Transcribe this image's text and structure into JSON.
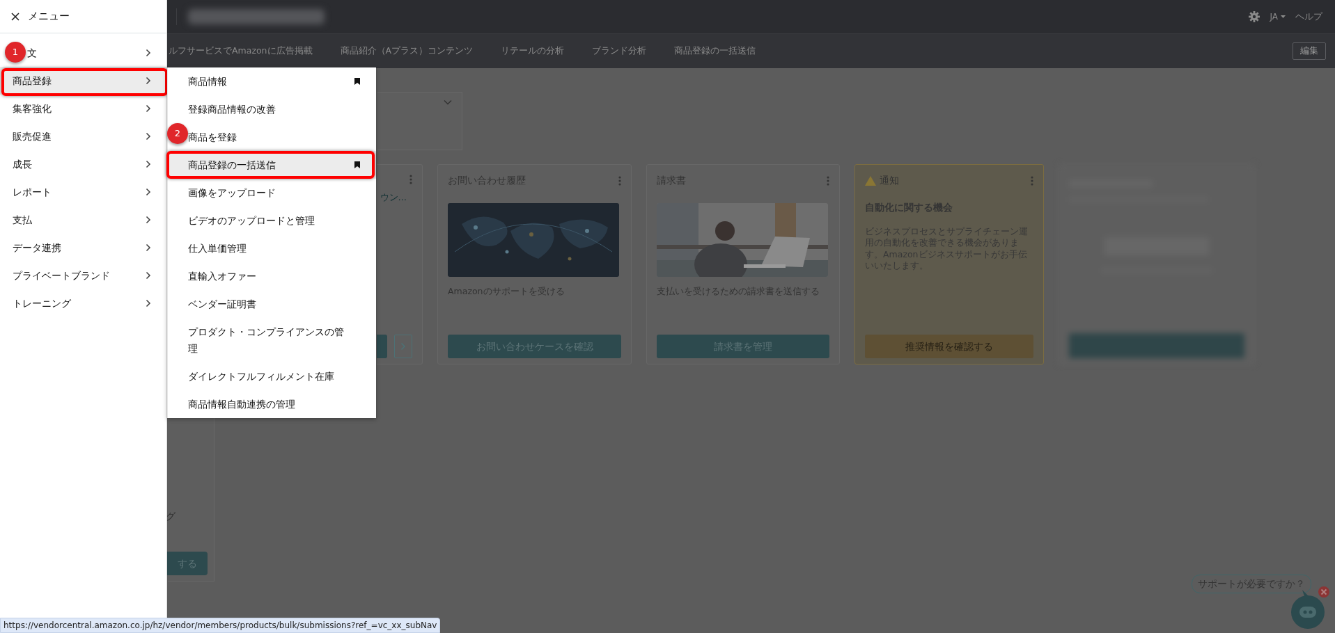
{
  "topbar": {
    "language": "JA",
    "help": "ヘルプ"
  },
  "nav_tabs": [
    {
      "label": "ルフサービスでAmazonに広告掲載"
    },
    {
      "label": "商品紹介（Aプラス）コンテンツ"
    },
    {
      "label": "リテールの分析"
    },
    {
      "label": "ブランド分析"
    },
    {
      "label": "商品登録の一括送信"
    }
  ],
  "edit_button": "編集",
  "left_card": {
    "text": "グ",
    "button": "する"
  },
  "cards": [
    {
      "kind": "partial",
      "link": "ウン…"
    },
    {
      "kind": "map",
      "title": "お問い合わせ履歴",
      "description": "Amazonのサポートを受ける",
      "button": "お問い合わせケースを確認"
    },
    {
      "title": "請求書",
      "description": "支払いを受けるための請求書を送信する",
      "button": "請求書を管理"
    },
    {
      "kind": "notice",
      "title": "通知",
      "heading": "自動化に関する機会",
      "body": "ビジネスプロセスとサプライチェーン運用の自動化を改善できる機会があります。Amazonビジネスサポートがお手伝いいたします。",
      "button": "推奨情報を確認する"
    },
    {
      "kind": "blurred"
    }
  ],
  "menu": {
    "title": "メニュー",
    "items": [
      {
        "label": "文",
        "selected": false,
        "highlighted": false,
        "annotation": "1"
      },
      {
        "label": "商品登録",
        "selected": true,
        "highlighted": true
      },
      {
        "label": "集客強化",
        "selected": false,
        "highlighted": false
      },
      {
        "label": "販売促進",
        "selected": false,
        "highlighted": false
      },
      {
        "label": "成長",
        "selected": false,
        "highlighted": false
      },
      {
        "label": "レポート",
        "selected": false,
        "highlighted": false
      },
      {
        "label": "支払",
        "selected": false,
        "highlighted": false
      },
      {
        "label": "データ連携",
        "selected": false,
        "highlighted": false
      },
      {
        "label": "プライベートブランド",
        "selected": false,
        "highlighted": false
      },
      {
        "label": "トレーニング",
        "selected": false,
        "highlighted": false
      }
    ]
  },
  "submenu": {
    "items": [
      {
        "label": "商品情報",
        "bookmarked": true,
        "selected": false,
        "highlighted": false
      },
      {
        "label": "登録商品情報の改善",
        "bookmarked": false,
        "selected": false,
        "highlighted": false
      },
      {
        "label": "商品を登録",
        "bookmarked": false,
        "selected": false,
        "highlighted": false,
        "annotation": "2"
      },
      {
        "label": "商品登録の一括送信",
        "bookmarked": true,
        "selected": true,
        "highlighted": true
      },
      {
        "label": "画像をアップロード",
        "bookmarked": false,
        "selected": false,
        "highlighted": false
      },
      {
        "label": "ビデオのアップロードと管理",
        "bookmarked": false,
        "selected": false,
        "highlighted": false
      },
      {
        "label": "仕入単価管理",
        "bookmarked": false,
        "selected": false,
        "highlighted": false
      },
      {
        "label": "直輸入オファー",
        "bookmarked": false,
        "selected": false,
        "highlighted": false
      },
      {
        "label": "ベンダー証明書",
        "bookmarked": false,
        "selected": false,
        "highlighted": false
      },
      {
        "label": "プロダクト・コンプライアンスの管理",
        "bookmarked": false,
        "selected": false,
        "highlighted": false
      },
      {
        "label": "ダイレクトフルフィルメント在庫",
        "bookmarked": false,
        "selected": false,
        "highlighted": false
      },
      {
        "label": "商品情報自動連携の管理",
        "bookmarked": false,
        "selected": false,
        "highlighted": false
      }
    ]
  },
  "status_bar": {
    "url": "https://vendorcentral.amazon.co.jp/hz/vendor/members/products/bulk/submissions?ref_=vc_xx_subNav"
  },
  "chat": {
    "prompt": "サポートが必要ですか？"
  }
}
